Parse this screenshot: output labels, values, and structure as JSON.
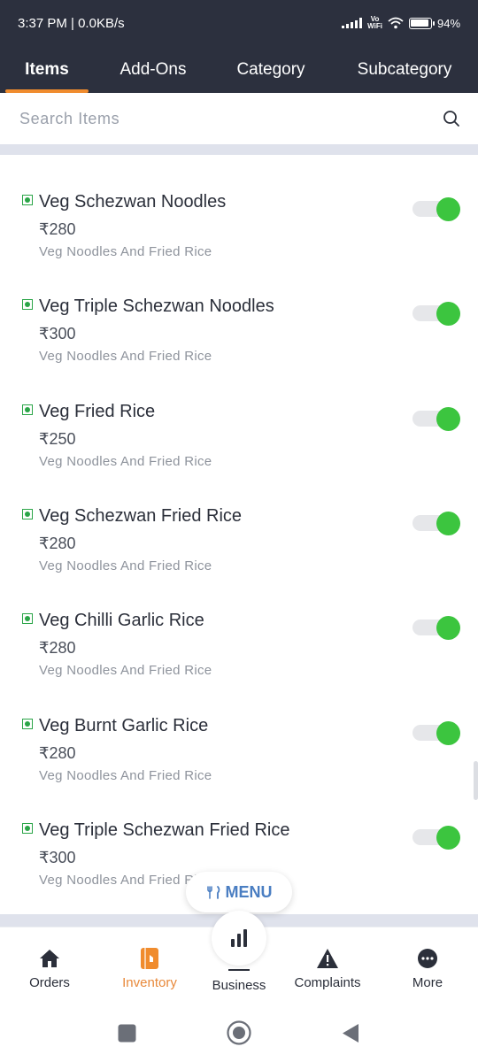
{
  "status_bar": {
    "time": "3:37 PM | 0.0KB/s",
    "network": "Vo WiFi",
    "battery": "94"
  },
  "tabs": [
    {
      "label": "Items",
      "active": true
    },
    {
      "label": "Add-Ons",
      "active": false
    },
    {
      "label": "Category",
      "active": false
    },
    {
      "label": "Subcategory",
      "active": false
    }
  ],
  "search": {
    "placeholder": "Search Items"
  },
  "items": [
    {
      "name": "Veg Schezwan Noodles",
      "price": "₹280",
      "category": "Veg Noodles And Fried Rice",
      "enabled": true
    },
    {
      "name": "Veg Triple Schezwan Noodles",
      "price": "₹300",
      "category": "Veg Noodles And Fried Rice",
      "enabled": true
    },
    {
      "name": "Veg Fried Rice",
      "price": "₹250",
      "category": "Veg Noodles And Fried Rice",
      "enabled": true
    },
    {
      "name": "Veg Schezwan Fried Rice",
      "price": "₹280",
      "category": "Veg Noodles And Fried Rice",
      "enabled": true
    },
    {
      "name": "Veg Chilli Garlic Rice",
      "price": "₹280",
      "category": "Veg Noodles And Fried Rice",
      "enabled": true
    },
    {
      "name": "Veg Burnt Garlic Rice",
      "price": "₹280",
      "category": "Veg Noodles And Fried Rice",
      "enabled": true
    },
    {
      "name": "Veg Triple Schezwan Fried Rice",
      "price": "₹300",
      "category": "Veg Noodles And Fried Rice",
      "enabled": true
    }
  ],
  "menu_button": {
    "label": "MENU"
  },
  "bottom_nav": {
    "orders": "Orders",
    "inventory": "Inventory",
    "business": "Business",
    "complaints": "Complaints",
    "more": "More"
  },
  "colors": {
    "header_bg": "#2c303e",
    "accent": "#f08c2e",
    "toggle_on": "#3cc53f",
    "veg_green": "#2aa547",
    "menu_blue": "#4a7ec2"
  }
}
